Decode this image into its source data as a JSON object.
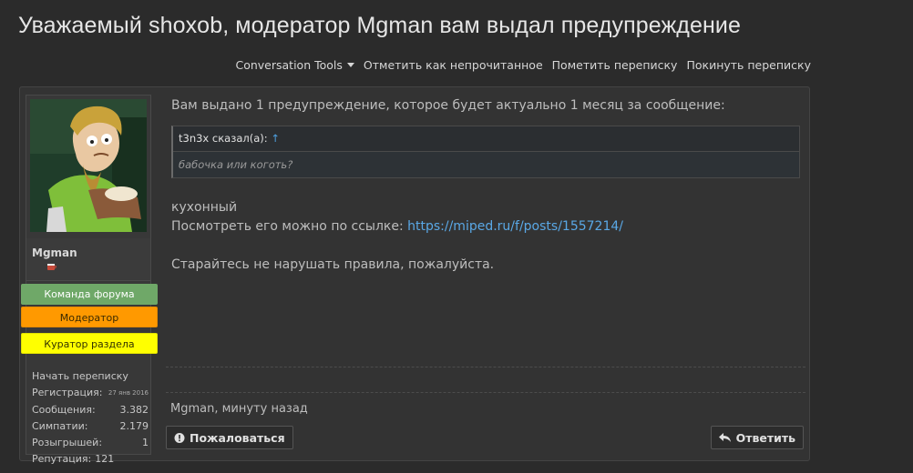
{
  "page": {
    "title": "Уважаемый shoxob, модератор Mgman вам выдал предупреждение"
  },
  "toolbar": {
    "items": [
      "Conversation Tools",
      "Отметить как непрочитанное",
      "Пометить переписку",
      "Покинуть переписку"
    ]
  },
  "user": {
    "name": "Mgman",
    "badges": [
      "Команда форума",
      "Модератор",
      "Куратор раздела"
    ],
    "start_convo": "Начать переписку",
    "stats": [
      {
        "label": "Регистрация:",
        "value": "27 янв 2016"
      },
      {
        "label": "Сообщения:",
        "value": "3.382"
      },
      {
        "label": "Симпатии:",
        "value": "2.179"
      },
      {
        "label": "Розыгрышей:",
        "value": "1"
      },
      {
        "label": "Репутация:",
        "value": "121"
      }
    ]
  },
  "message": {
    "intro": "Вам выдано 1 предупреждение, которое будет актуально 1 месяц за сообщение:",
    "quote_author": "t3n3x сказал(а):",
    "quote_arrow": "↑",
    "quote_text": "бабочка или коготь?",
    "reason": "кухонный",
    "link_prefix": "Посмотреть его можно по ссылке: ",
    "link": "https://miped.ru/f/posts/1557214/",
    "closing": "Старайтесь не нарушать правила, пожалуйста."
  },
  "meta": {
    "author": "Mgman",
    "sep": ", ",
    "time": "минуту назад"
  },
  "actions": {
    "report": "Пожаловаться",
    "reply": "Ответить"
  },
  "colors": {
    "team": "#6fa868",
    "moderator": "#ff9900",
    "curator": "#ffff00",
    "link": "#5aa8e6"
  }
}
